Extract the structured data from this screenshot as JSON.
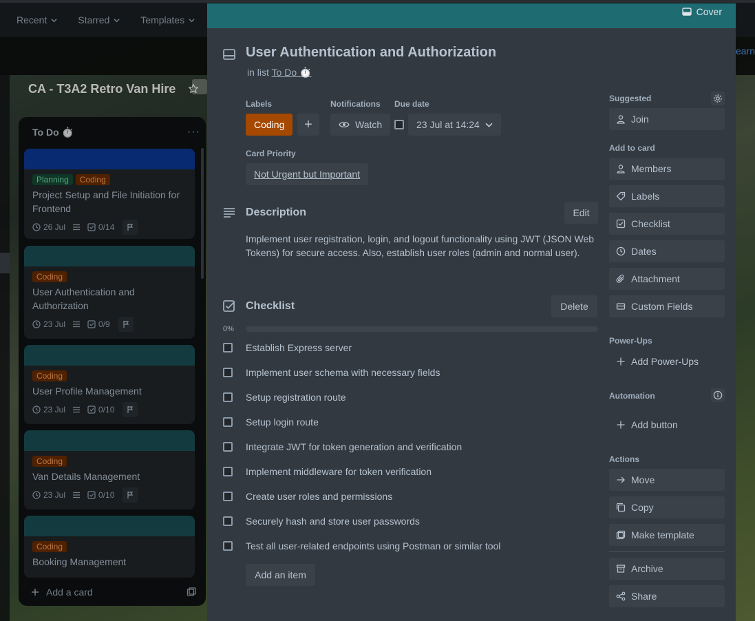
{
  "topnav": {
    "items": [
      "Recent",
      "Starred",
      "Templates"
    ]
  },
  "subbar": {
    "learn_text": "Learn"
  },
  "board": {
    "title": "CA - T3A2 Retro Van Hire",
    "list": {
      "title": "To Do ⏱️",
      "menu": "···",
      "add_card": "Add a card",
      "cards": [
        {
          "cover_color": "#0c3b9c",
          "labels": [
            {
              "text": "Planning",
              "color": "green"
            },
            {
              "text": "Coding",
              "color": "orange"
            }
          ],
          "title": "Project Setup and File Initiation for Frontend",
          "date": "26 Jul",
          "checklist": "0/14"
        },
        {
          "cover_color": "#1b5358",
          "labels": [
            {
              "text": "Coding",
              "color": "orange"
            }
          ],
          "title": "User Authentication and Authorization",
          "date": "23 Jul",
          "checklist": "0/9"
        },
        {
          "cover_color": "#1b5358",
          "labels": [
            {
              "text": "Coding",
              "color": "orange"
            }
          ],
          "title": "User Profile Management",
          "date": "23 Jul",
          "checklist": "0/10"
        },
        {
          "cover_color": "#1b5358",
          "labels": [
            {
              "text": "Coding",
              "color": "orange"
            }
          ],
          "title": "Van Details Management",
          "date": "23 Jul",
          "checklist": "0/10"
        },
        {
          "cover_color": "#1b5358",
          "labels": [
            {
              "text": "Coding",
              "color": "orange"
            }
          ],
          "title": "Booking Management",
          "date": "",
          "checklist": ""
        }
      ]
    }
  },
  "modal": {
    "cover_button": "Cover",
    "title": "User Authentication and Authorization",
    "in_list_prefix": "in list",
    "in_list_name": "To Do ⏱️",
    "labels_heading": "Labels",
    "label_chip": "Coding",
    "add_label": "+",
    "notifications_heading": "Notifications",
    "watch_button": "Watch",
    "due_heading": "Due date",
    "due_value": "23 Jul at 14:24",
    "priority_heading": "Card Priority",
    "priority_value": "Not Urgent but Important",
    "description_heading": "Description",
    "edit_button": "Edit",
    "description_text": "Implement user registration, login, and logout functionality using JWT (JSON Web Tokens) for secure access. Also, establish user roles (admin and normal user).",
    "checklist_heading": "Checklist",
    "delete_button": "Delete",
    "progress_text": "0%",
    "progress_value": 0,
    "checklist_items": [
      "Establish Express server",
      "Implement user schema with necessary fields",
      "Setup registration route",
      "Setup login route",
      "Integrate JWT for token generation and verification",
      "Implement middleware for token verification",
      "Create user roles and permissions",
      "Securely hash and store user passwords",
      "Test all user-related endpoints using Postman or similar tool"
    ],
    "add_item_button": "Add an item"
  },
  "sidebar": {
    "suggested_heading": "Suggested",
    "join": "Join",
    "add_to_card_heading": "Add to card",
    "members": "Members",
    "labels": "Labels",
    "checklist": "Checklist",
    "dates": "Dates",
    "attachment": "Attachment",
    "custom_fields": "Custom Fields",
    "powerups_heading": "Power-Ups",
    "add_powerups": "Add Power-Ups",
    "automation_heading": "Automation",
    "add_button": "Add button",
    "actions_heading": "Actions",
    "move": "Move",
    "copy": "Copy",
    "make_template": "Make template",
    "archive": "Archive",
    "share": "Share"
  }
}
